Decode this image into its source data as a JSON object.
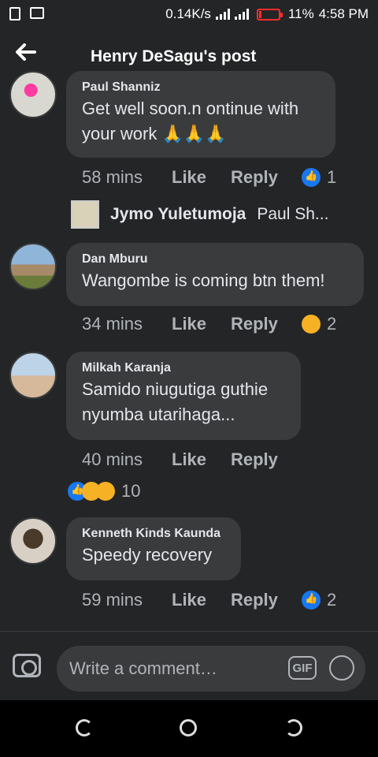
{
  "status_bar": {
    "speed": "0.14K/s",
    "battery_pct": "11%",
    "time": "4:58 PM",
    "battery_level": 0.11
  },
  "header": {
    "title": "Henry DeSagu's post"
  },
  "comments": [
    {
      "name": "Paul Shanniz",
      "text_line1": "Get well soon.n ontinue with",
      "text_line2": "your work 🙏🙏🙏",
      "time": "58 mins",
      "like": "Like",
      "reply": "Reply",
      "reaction_count": "1"
    },
    {
      "name": "Dan Mburu",
      "text_line1": "Wangombe is coming btn them!",
      "time": "34 mins",
      "like": "Like",
      "reply": "Reply",
      "reaction_count": "2"
    },
    {
      "name": "Milkah Karanja",
      "text_line1": "Samido niugutiga guthie",
      "text_line2": "nyumba utarihaga...",
      "time": "40 mins",
      "like": "Like",
      "reply": "Reply",
      "reaction_count": "10"
    },
    {
      "name": "Kenneth Kinds Kaunda",
      "text_line1": "Speedy recovery",
      "time": "59 mins",
      "like": "Like",
      "reply": "Reply",
      "reaction_count": "2"
    }
  ],
  "reply_preview": {
    "name": "Jymo Yuletumoja",
    "text": "Paul Sh..."
  },
  "composer": {
    "placeholder": "Write a comment…",
    "gif_label": "GIF"
  },
  "icons": {
    "back": "back-arrow-icon",
    "camera": "camera-icon",
    "gif": "gif-icon",
    "emoji": "emoji-icon"
  },
  "colors": {
    "background": "#242526",
    "bubble": "#3a3b3c",
    "like_blue": "#1877f2",
    "battery_red": "#ff2d2d"
  }
}
